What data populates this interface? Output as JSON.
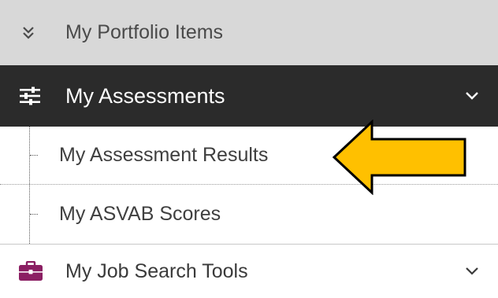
{
  "nav": {
    "portfolio": {
      "label": "My Portfolio Items",
      "icon": "double-chevron-down-icon"
    },
    "assessments": {
      "label": "My Assessments",
      "icon": "sliders-icon",
      "expanded": true,
      "children": [
        {
          "label": "My Assessment Results"
        },
        {
          "label": "My ASVAB Scores"
        }
      ]
    },
    "job_search": {
      "label": "My Job Search Tools",
      "icon": "briefcase-icon"
    }
  },
  "annotation": {
    "type": "callout-arrow",
    "color": "#ffc000",
    "points_to": "My Assessment Results"
  },
  "colors": {
    "portfolio_bg": "#d8d8d8",
    "assessments_bg": "#2b2b2b",
    "briefcase": "#8b1f63",
    "arrow": "#ffc000"
  }
}
